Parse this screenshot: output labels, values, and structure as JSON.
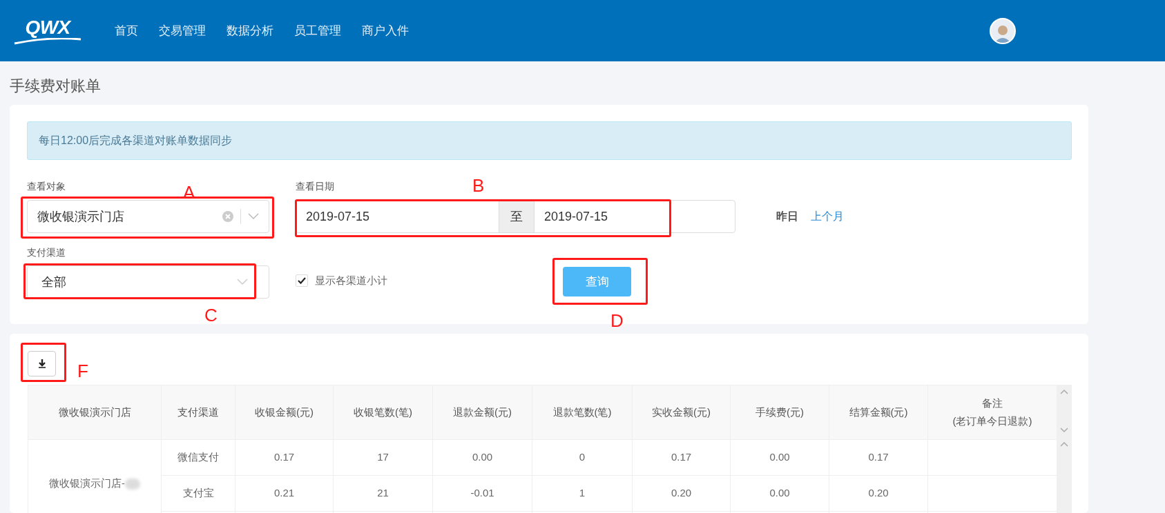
{
  "header": {
    "logo": "QWX",
    "nav": [
      {
        "label": "首页",
        "selected": false
      },
      {
        "label": "交易管理",
        "selected": false
      },
      {
        "label": "数据分析",
        "selected": false
      },
      {
        "label": "员工管理",
        "selected": false
      },
      {
        "label": "商户入件",
        "selected": false
      }
    ]
  },
  "page_title": "手续费对账单",
  "alert": "每日12:00后完成各渠道对账单数据同步",
  "filters": {
    "target": {
      "label": "查看对象",
      "value": "微收银演示门店"
    },
    "date": {
      "label": "查看日期",
      "start": "2019-07-15",
      "separator": "至",
      "end": "2019-07-15"
    },
    "quick_dates": [
      {
        "label": "昨日",
        "selected": true
      },
      {
        "label": "上个月",
        "selected": false
      }
    ],
    "channel": {
      "label": "支付渠道",
      "value": "全部"
    },
    "show_subtotals": {
      "label": "显示各渠道小计",
      "checked": true
    },
    "query_button": "查询"
  },
  "annotations": [
    {
      "label": "A"
    },
    {
      "label": "B"
    },
    {
      "label": "C"
    },
    {
      "label": "D"
    },
    {
      "label": "F"
    }
  ],
  "table": {
    "columns": [
      "微收银演示门店",
      "支付渠道",
      "收银金额(元)",
      "收银笔数(笔)",
      "退款金额(元)",
      "退款笔数(笔)",
      "实收金额(元)",
      "手续费(元)",
      "结算金额(元)",
      "备注\n(老订单今日退款)"
    ],
    "groups": [
      {
        "store": "微收银演示门店-",
        "rows": [
          [
            "微信支付",
            "0.17",
            "17",
            "0.00",
            "0",
            "0.17",
            "0.00",
            "0.17",
            ""
          ],
          [
            "支付宝",
            "0.21",
            "21",
            "-0.01",
            "1",
            "0.20",
            "0.00",
            "0.20",
            ""
          ]
        ]
      }
    ]
  }
}
